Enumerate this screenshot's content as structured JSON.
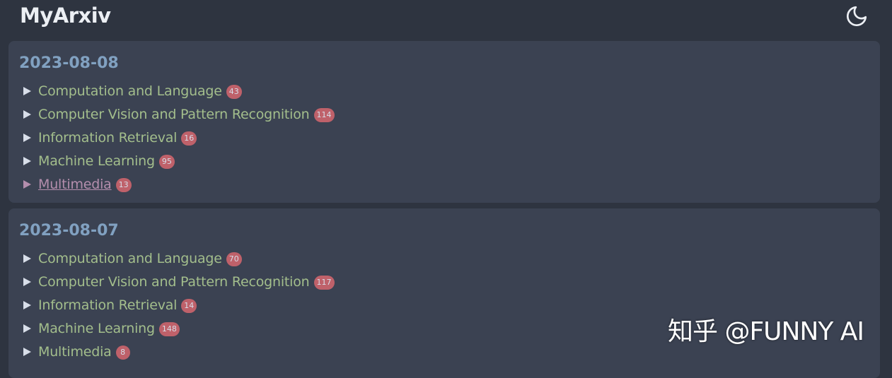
{
  "header": {
    "app_title": "MyArxiv",
    "theme_toggle_icon": "moon-icon"
  },
  "days": [
    {
      "date": "2023-08-08",
      "categories": [
        {
          "label": "Computation and Language",
          "count": "43"
        },
        {
          "label": "Computer Vision and Pattern Recognition",
          "count": "114"
        },
        {
          "label": "Information Retrieval",
          "count": "16"
        },
        {
          "label": "Machine Learning",
          "count": "95"
        },
        {
          "label": "Multimedia",
          "count": "13"
        }
      ]
    },
    {
      "date": "2023-08-07",
      "categories": [
        {
          "label": "Computation and Language",
          "count": "70"
        },
        {
          "label": "Computer Vision and Pattern Recognition",
          "count": "117"
        },
        {
          "label": "Information Retrieval",
          "count": "14"
        },
        {
          "label": "Machine Learning",
          "count": "148"
        },
        {
          "label": "Multimedia",
          "count": "8"
        }
      ]
    }
  ],
  "watermark": "知乎 @FUNNY AI",
  "colors": {
    "background": "#2e3440",
    "card": "#3b4252",
    "date": "#81a1c1",
    "category": "#a3be8c",
    "category_hover": "#b48ead",
    "badge": "#bf616a"
  }
}
